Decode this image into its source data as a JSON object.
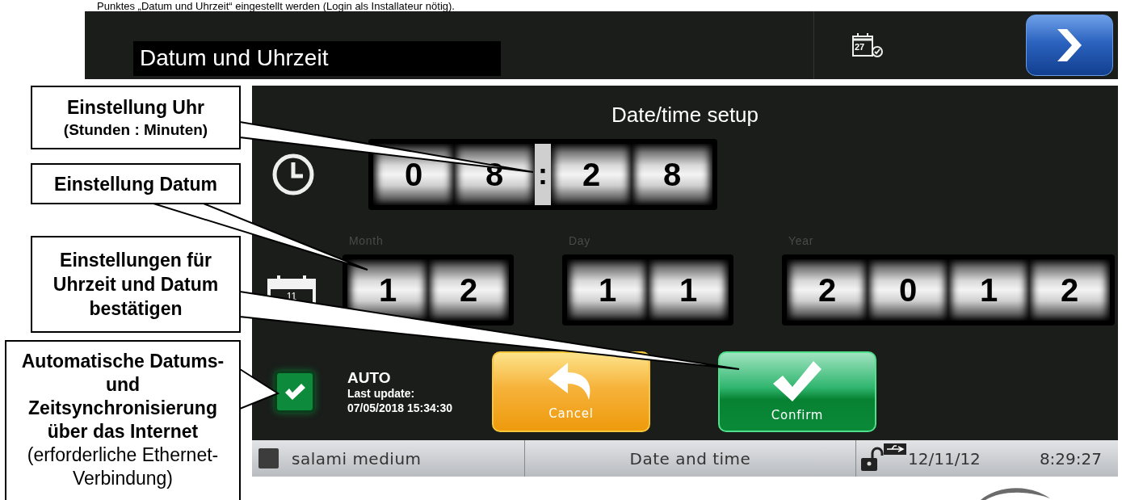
{
  "document_text": "Punktes „Datum und Uhrzeit“ eingestellt werden (Login als Installateur nötig).",
  "header": {
    "title": "Datum und Uhrzeit",
    "icon_day": "27"
  },
  "screen": {
    "title": "Date/time setup",
    "time": {
      "digits": [
        "0",
        "8",
        "2",
        "8"
      ],
      "separator": ":"
    },
    "date": [
      {
        "label": "Month",
        "digits": [
          "1",
          "2"
        ]
      },
      {
        "label": "Day",
        "digits": [
          "1",
          "1"
        ]
      },
      {
        "label": "Year",
        "digits": [
          "2",
          "0",
          "1",
          "2"
        ]
      }
    ],
    "calendar_day": "11",
    "auto": {
      "checked": true,
      "label": "AUTO",
      "last_update_label": "Last update:",
      "last_update": "07/05/2018 15:34:30"
    },
    "buttons": [
      {
        "kind": "cancel",
        "label": "Cancel"
      },
      {
        "kind": "confirm",
        "label": "Confirm"
      }
    ],
    "status_bar": {
      "device": "salami medium",
      "page": "Date and time",
      "locked": false,
      "date": "12/11/12",
      "time": "8:29:27"
    }
  },
  "callouts": [
    {
      "kind": "heading",
      "text": "Einstellung Uhr",
      "note": "(Stunden : Minuten)"
    },
    {
      "kind": "heading",
      "text": "Einstellung Datum"
    },
    {
      "kind": "heading",
      "text": "Einstellungen für Uhrzeit und Datum bestätigen"
    },
    {
      "kind": "paragraph",
      "text": "**Automatische Datums- und Zeitsynchronisierung über das Internet** (erforderliche Ethernet-Verbindung)"
    }
  ]
}
